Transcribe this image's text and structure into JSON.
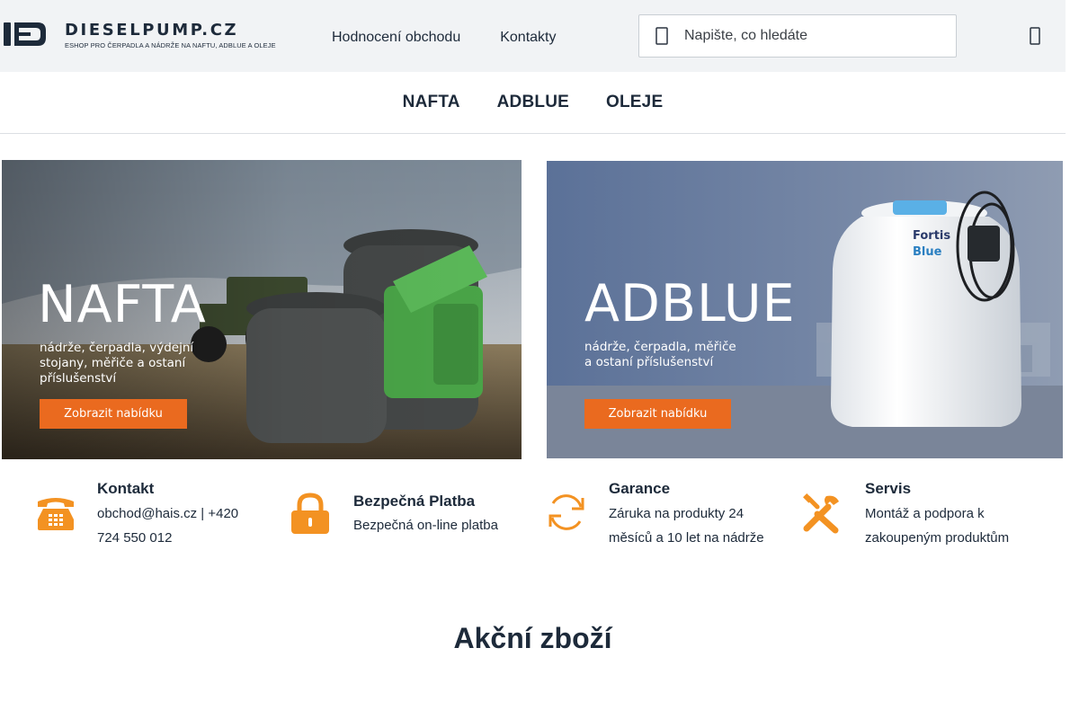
{
  "logo": {
    "name": "DIESELPUMP.CZ",
    "tagline": "ESHOP PRO ČERPADLA A NÁDRŽE NA NAFTU, ADBLUE A OLEJE"
  },
  "topnav": [
    {
      "label": "Hodnocení obchodu"
    },
    {
      "label": "Kontakty"
    }
  ],
  "search": {
    "placeholder": "Napište, co hledáte",
    "value": ""
  },
  "catnav": [
    {
      "label": "NAFTA"
    },
    {
      "label": "ADBLUE"
    },
    {
      "label": "OLEJE"
    }
  ],
  "banners": {
    "nafta": {
      "title": "NAFTA",
      "subtitle": "nádrže, čerpadla, výdejní\nstojany, měřiče a ostaní\npříslušenství",
      "button": "Zobrazit nabídku"
    },
    "adblue": {
      "title": "ADBLUE",
      "subtitle": "nádrže, čerpadla, měřiče\na ostaní příslušenství",
      "button": "Zobrazit nabídku",
      "product_text": "Fortis Blue"
    }
  },
  "features": [
    {
      "title": "Kontakt",
      "text_lines": [
        "obchod@hais.cz | +420",
        "724 550 012"
      ]
    },
    {
      "title": "Bezpečná Platba",
      "text_lines": [
        "Bezpečná on-line platba"
      ]
    },
    {
      "title": "Garance",
      "text_lines": [
        "Záruka na produkty 24",
        "měsíců a 10 let na nádrže"
      ]
    },
    {
      "title": "Servis",
      "text_lines": [
        "Montáž a podpora k",
        "zakoupeným produktům"
      ]
    }
  ],
  "section_title": "Akční zboží",
  "colors": {
    "accent": "#ea6a1f",
    "icon_orange": "#f39222",
    "header_bg": "#f1f3f5",
    "text_dark": "#1d2a3a"
  },
  "icons": [
    "logo-mark-icon",
    "search-icon",
    "cart-icon",
    "phone-icon",
    "lock-icon",
    "refresh-icon",
    "tools-icon"
  ]
}
